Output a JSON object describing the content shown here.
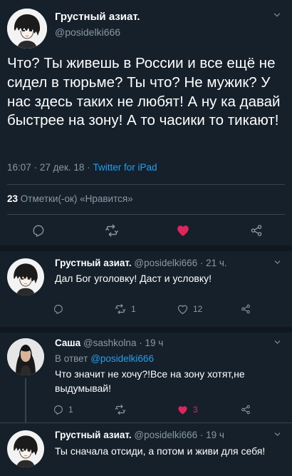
{
  "main_tweet": {
    "name": "Грустный азиат.",
    "handle": "@posidelki666",
    "text": "Что? Ты живешь в России и все ещё не сидел в тюрьме? Ты что? Не мужик? У нас здесь таких не любят! А ну ка давай быстрее на зону! А то часики то тикают!",
    "time": "16:07",
    "sep": "·",
    "date": "27 дек. 18",
    "source": "Twitter for iPad",
    "likes_count": "23",
    "likes_label": "Отметки(-ок) «Нравится»"
  },
  "replies": [
    {
      "name": "Грустный азиат.",
      "handle": "@posidelki666 · 21 ч.",
      "text": "Дал Бог уголовку! Даст и условку!",
      "retweets": "1",
      "likes": "12"
    },
    {
      "name": "Саша",
      "handle": "@sashkolna · 19 ч",
      "reply_prefix": "В ответ",
      "reply_to": "@posidelki666",
      "text": "Что значит не хочу?!Все на зону хотят,не выдумывай!",
      "replies": "1",
      "likes": "3"
    },
    {
      "name": "Грустный азиат.",
      "handle": "@posidelki666 · 19 ч",
      "text": "Ты сначала отсиди, а потом и живи для себя!"
    }
  ],
  "icons": {
    "reply": "reply-icon",
    "retweet": "retweet-icon",
    "like": "heart-icon",
    "share": "share-icon",
    "more": "chevron-down-icon"
  },
  "colors": {
    "background": "#15202b",
    "muted": "#8899a6",
    "link": "#1da1f2",
    "like_active": "#e0245e",
    "divider": "#38444d"
  }
}
